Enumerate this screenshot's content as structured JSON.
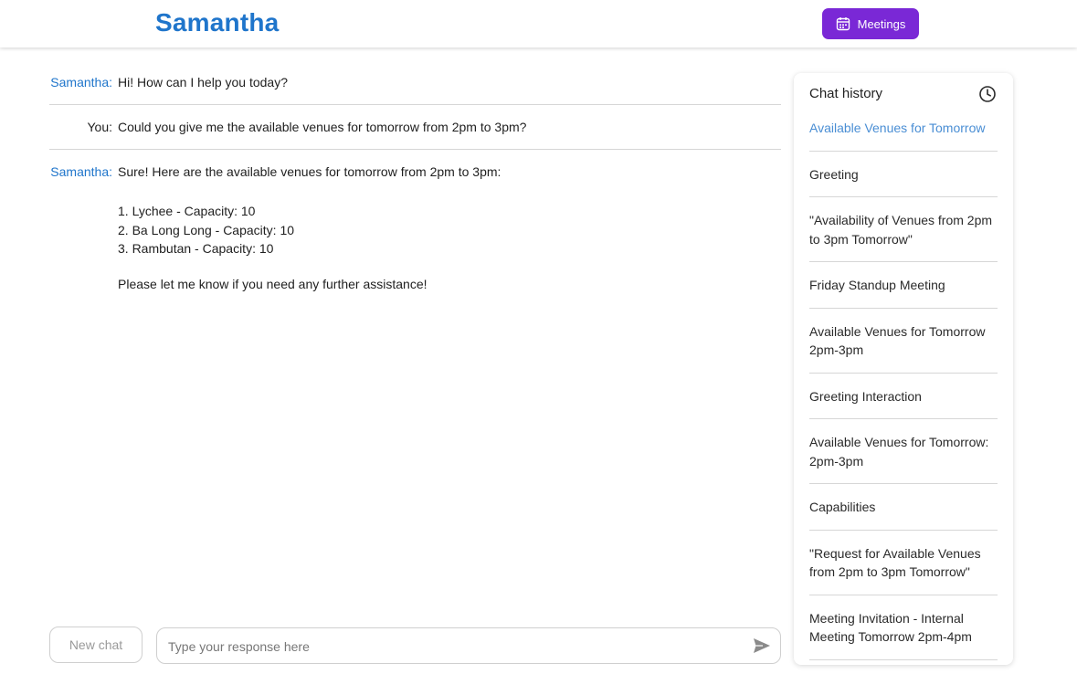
{
  "header": {
    "brand": "Samantha",
    "meetings_label": "Meetings",
    "meetings_icon": "calendar-icon",
    "accent": "#7a28d6",
    "brand_color": "#1f75cb"
  },
  "chat": {
    "messages": [
      {
        "speaker": "Samantha:",
        "text": "Hi! How can I help you today?"
      },
      {
        "speaker": "You:",
        "text": "Could you give me the available venues for tomorrow from 2pm to 3pm?"
      },
      {
        "speaker": "Samantha:",
        "text": "Sure! Here are the available venues for tomorrow from 2pm to 3pm:",
        "list": [
          "1. Lychee - Capacity: 10",
          "2. Ba Long Long - Capacity: 10",
          "3. Rambutan - Capacity: 10"
        ],
        "closing": "Please let me know if you need any further assistance!"
      }
    ]
  },
  "composer": {
    "new_chat_label": "New chat",
    "placeholder": "Type your response here",
    "send_icon": "send-icon"
  },
  "history": {
    "title": "Chat history",
    "icon": "clock-icon",
    "items": [
      "Available Venues for Tomorrow",
      "Greeting",
      "\"Availability of Venues from 2pm to 3pm Tomorrow\"",
      "Friday Standup Meeting",
      "Available Venues for Tomorrow 2pm-3pm",
      "Greeting Interaction",
      "Available Venues for Tomorrow: 2pm-3pm",
      "Capabilities",
      "\"Request for Available Venues from 2pm to 3pm Tomorrow\"",
      "Meeting Invitation - Internal Meeting Tomorrow 2pm-4pm"
    ]
  }
}
